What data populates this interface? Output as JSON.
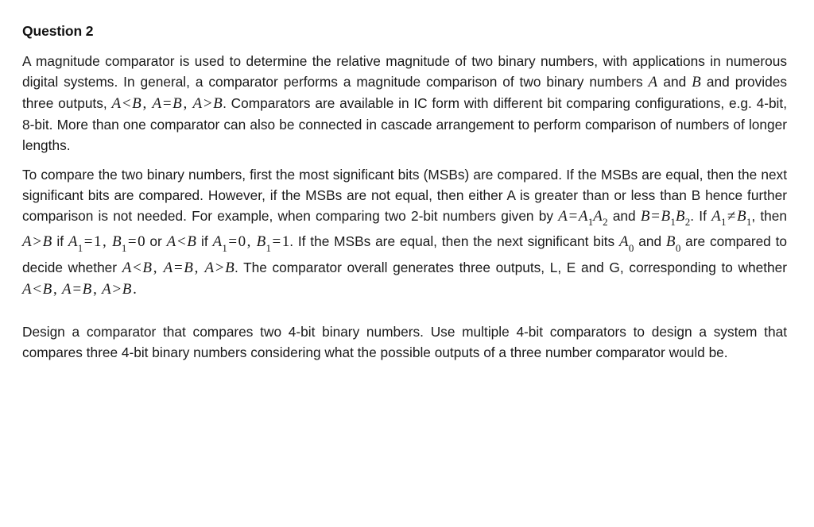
{
  "document": {
    "heading": "Question 2",
    "paragraphs": {
      "p1": {
        "seg1": "A magnitude comparator is used to determine the relative magnitude of two binary numbers, with applications in numerous digital systems. In general, a comparator performs a magnitude comparison of two binary numbers ",
        "var_a1": "A",
        "seg2": " and ",
        "var_b1": "B",
        "seg3": " and provides three outputs, ",
        "expr_lt_a": "A",
        "op_lt": "<",
        "expr_lt_b": "B",
        "comma1": ", ",
        "expr_eq_a": "A",
        "op_eq": "=",
        "expr_eq_b": "B",
        "comma2": ", ",
        "expr_gt_a": "A",
        "op_gt": ">",
        "expr_gt_b": "B",
        "seg4": ". Comparators are available in IC form with different bit comparing configurations, e.g. 4-bit, 8-bit. More than one comparator can also be connected in cascade arrangement to perform comparison of numbers of longer lengths."
      },
      "p2": {
        "seg1": "To compare the two binary numbers, first the most significant bits (MSBs) are compared.  If the MSBs are equal, then the next significant bits are compared. However, if the MSBs are not equal, then either A is greater than or less than B hence further comparison is not needed. For example, when comparing two 2-bit numbers given by ",
        "eq_a_var": "A",
        "eq_a_op": "=",
        "eq_a_v1": "A",
        "eq_a_s1": "1",
        "eq_a_v2": "A",
        "eq_a_s2": "2",
        "seg2": " and ",
        "eq_b_var": "B",
        "eq_b_op": "=",
        "eq_b_v1": "B",
        "eq_b_s1": "1",
        "eq_b_v2": "B",
        "eq_b_s2": "2",
        "seg3": ". If ",
        "neq_a": "A",
        "neq_a_sub": "1",
        "neq_op": "≠",
        "neq_b": "B",
        "neq_b_sub": "1",
        "seg4": ", then ",
        "gt_a": "A",
        "gt_op": ">",
        "gt_b": "B",
        "seg5": " if ",
        "a1_var": "A",
        "a1_sub": "1",
        "a1_op": "=",
        "a1_val": "1",
        "comma3": ", ",
        "b1_var": "B",
        "b1_sub": "1",
        "b1_op": "=",
        "b1_val": "0",
        "seg6": " or ",
        "lt_a": "A",
        "lt_op": "<",
        "lt_b": "B",
        "seg7": " if ",
        "a1b_var": "A",
        "a1b_sub": "1",
        "a1b_op": "=",
        "a1b_val": "0",
        "comma4": ", ",
        "b1b_var": "B",
        "b1b_sub": "1",
        "b1b_op": "=",
        "b1b_val": "1",
        "seg8": ". If the MSBs are equal, then the next significant bits ",
        "a0_var": "A",
        "a0_sub": "0",
        "seg9": " and ",
        "b0_var": "B",
        "b0_sub": "0",
        "seg10": " are compared to decide whether ",
        "w_lt_a": "A",
        "w_lt_op": "<",
        "w_lt_b": "B",
        "comma5": ", ",
        "w_eq_a": "A",
        "w_eq_op": "=",
        "w_eq_b": "B",
        "comma6": ", ",
        "w_gt_a": "A",
        "w_gt_op": ">",
        "w_gt_b": "B",
        "seg11": ".  The comparator overall generates three outputs, L, E and G, corresponding to whether ",
        "f_lt_a": "A",
        "f_lt_op": "<",
        "f_lt_b": "B",
        "comma7": ", ",
        "f_eq_a": "A",
        "f_eq_op": "=",
        "f_eq_b": "B",
        "comma8": ", ",
        "f_gt_a": "A",
        "f_gt_op": ">",
        "f_gt_b": "B",
        "seg12": "."
      },
      "p3": {
        "text": "Design a comparator that compares two 4-bit binary numbers. Use multiple 4-bit comparators to design a system that compares three 4-bit binary numbers considering what the possible outputs of a three number comparator would be."
      }
    }
  }
}
